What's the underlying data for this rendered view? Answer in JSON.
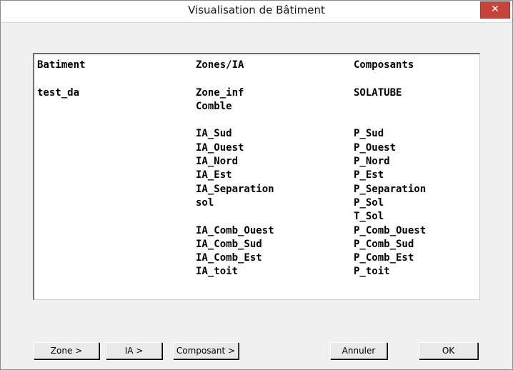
{
  "window": {
    "title": "Visualisation de Bâtiment",
    "close_label": "✕"
  },
  "list": {
    "columns": [
      {
        "header": "Batiment",
        "lines": [
          "",
          "test_da"
        ]
      },
      {
        "header": "Zones/IA",
        "lines": [
          "",
          "Zone_inf",
          "Comble",
          "",
          "IA_Sud",
          "IA_Ouest",
          "IA_Nord",
          "IA_Est",
          "IA_Separation",
          "sol",
          "",
          "IA_Comb_Ouest",
          "IA_Comb_Sud",
          "IA_Comb_Est",
          "IA_toit"
        ]
      },
      {
        "header": "Composants",
        "lines": [
          "",
          "SOLATUBE",
          "",
          "",
          "P_Sud",
          "P_Ouest",
          "P_Nord",
          "P_Est",
          "P_Separation",
          "P_Sol",
          "T_Sol",
          "P_Comb_Ouest",
          "P_Comb_Sud",
          "P_Comb_Est",
          "P_toit"
        ]
      }
    ]
  },
  "buttons": {
    "zone": "Zone >",
    "ia": "IA >",
    "composant": "Composant >",
    "annuler": "Annuler",
    "ok": "OK"
  },
  "colors": {
    "close_button": "#c7443a",
    "window_background": "#f0f0f0",
    "list_background": "#ffffff"
  }
}
